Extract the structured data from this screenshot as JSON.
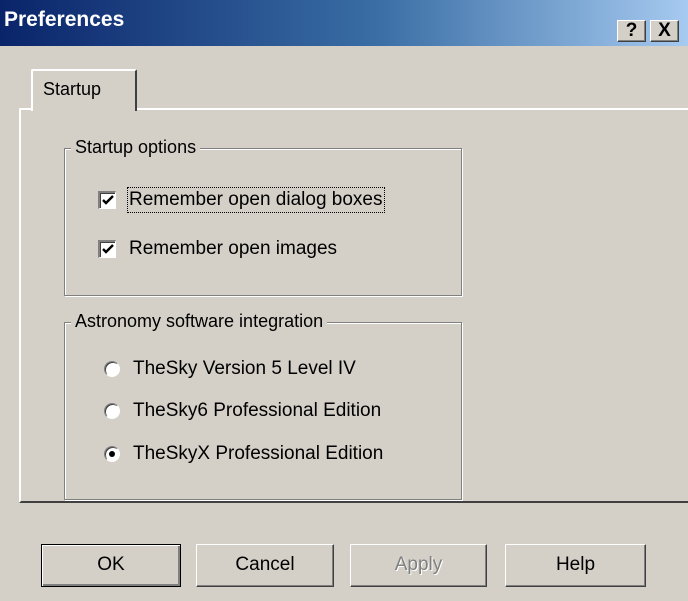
{
  "window": {
    "title": "Preferences",
    "help_button": "?",
    "close_button": "X"
  },
  "tabs": [
    {
      "label": "Startup",
      "selected": true
    }
  ],
  "startup_options": {
    "legend": "Startup options",
    "items": [
      {
        "label": "Remember open dialog boxes",
        "checked": true,
        "focused": true
      },
      {
        "label": "Remember open images",
        "checked": true
      }
    ]
  },
  "astronomy": {
    "legend": "Astronomy software integration",
    "options": [
      {
        "label": "TheSky Version 5 Level IV",
        "selected": false
      },
      {
        "label": "TheSky6 Professional Edition",
        "selected": false
      },
      {
        "label": "TheSkyX Professional Edition",
        "selected": true
      }
    ]
  },
  "buttons": {
    "ok": "OK",
    "cancel": "Cancel",
    "apply": "Apply",
    "help": "Help"
  },
  "colors": {
    "face": "#d4d0c8",
    "title_gradient_start": "#0a246a",
    "title_gradient_end": "#a6caf0",
    "disabled_text": "#808080"
  }
}
